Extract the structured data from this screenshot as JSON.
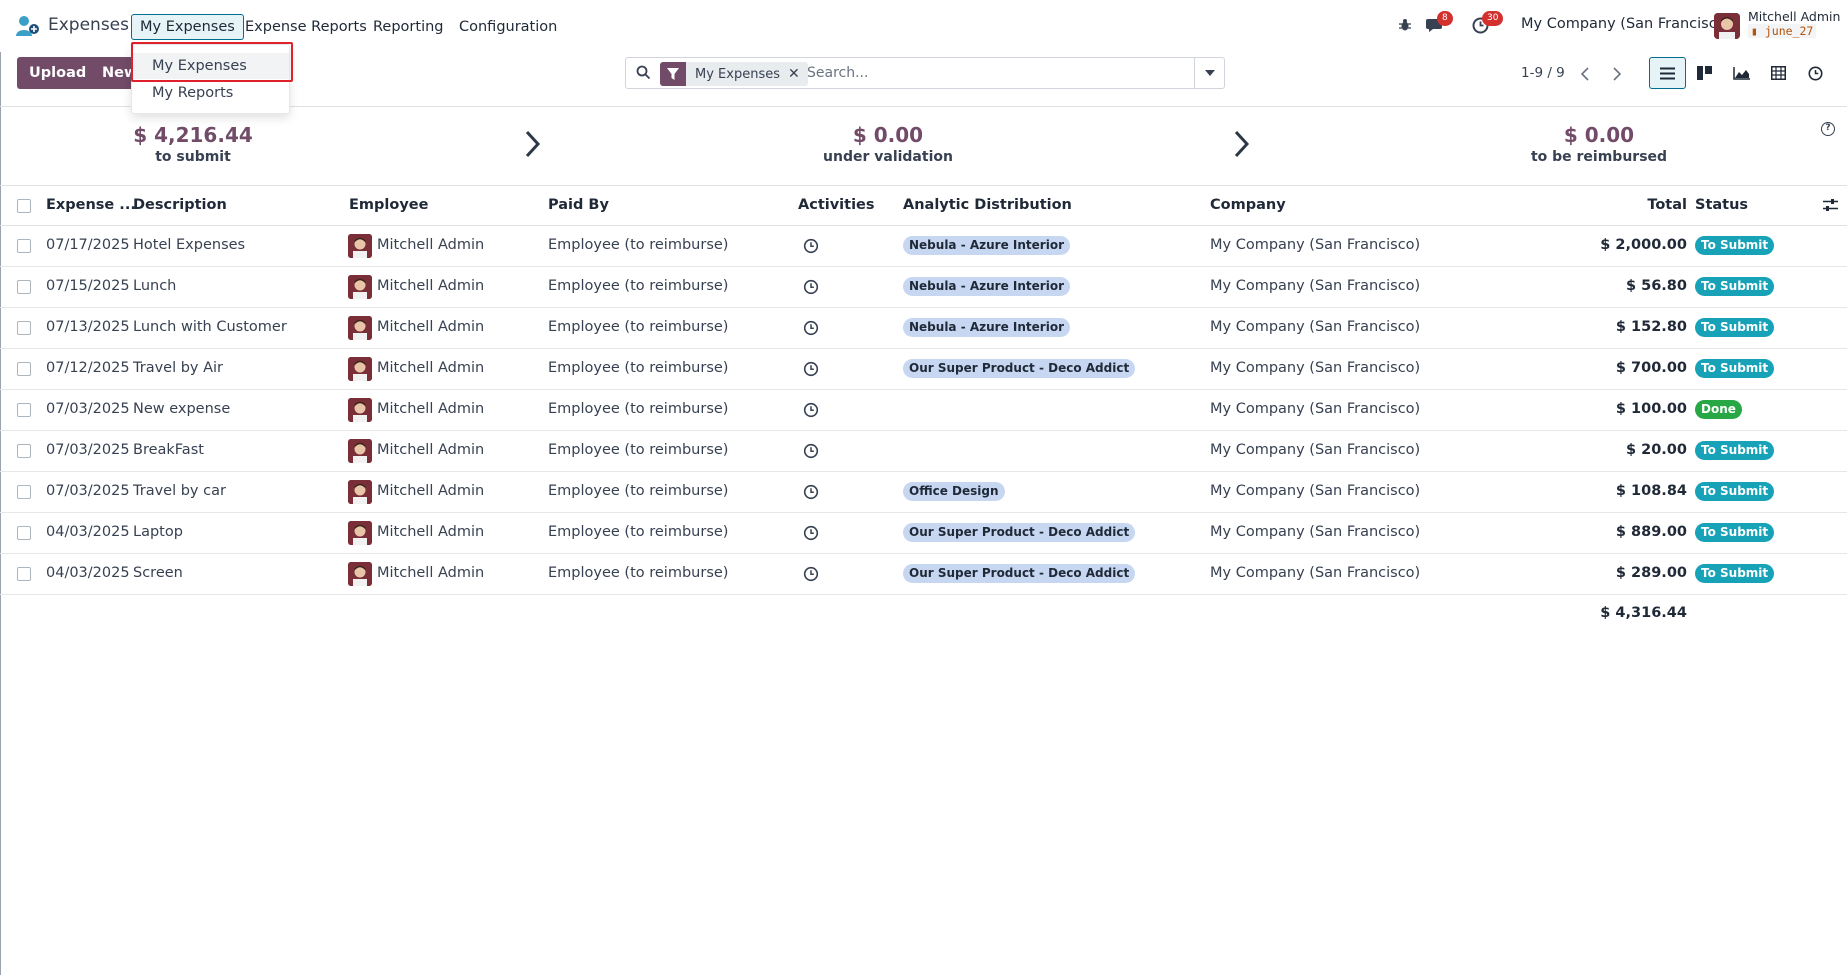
{
  "app": {
    "name": "Expenses"
  },
  "nav": {
    "menus": [
      "My Expenses",
      "Expense Reports",
      "Reporting",
      "Configuration"
    ],
    "messages_badge": "8",
    "activities_badge": "30",
    "company": "My Company (San Francisco)",
    "user_name": "Mitchell Admin",
    "database": "june_27"
  },
  "dropdown": {
    "items": [
      "My Expenses",
      "My Reports"
    ]
  },
  "control": {
    "upload_label": "Upload",
    "new_label": "New",
    "facet_label": "My Expenses",
    "search_placeholder": "Search...",
    "pager": "1-9 / 9"
  },
  "summary": [
    {
      "amount": "$ 4,216.44",
      "label": "to submit"
    },
    {
      "amount": "$ 0.00",
      "label": "under validation"
    },
    {
      "amount": "$ 0.00",
      "label": "to be reimbursed"
    }
  ],
  "table": {
    "headers": [
      "Expense ...",
      "Description",
      "Employee",
      "Paid By",
      "Activities",
      "Analytic Distribution",
      "Company",
      "Total",
      "Status"
    ],
    "rows": [
      {
        "date": "07/17/2025",
        "description": "Hotel Expenses",
        "employee": "Mitchell Admin",
        "paid_by": "Employee (to reimburse)",
        "analytic": "Nebula - Azure Interior",
        "company": "My Company (San Francisco)",
        "total": "$ 2,000.00",
        "status": "To Submit"
      },
      {
        "date": "07/15/2025",
        "description": "Lunch",
        "employee": "Mitchell Admin",
        "paid_by": "Employee (to reimburse)",
        "analytic": "Nebula - Azure Interior",
        "company": "My Company (San Francisco)",
        "total": "$ 56.80",
        "status": "To Submit"
      },
      {
        "date": "07/13/2025",
        "description": "Lunch with Customer",
        "employee": "Mitchell Admin",
        "paid_by": "Employee (to reimburse)",
        "analytic": "Nebula - Azure Interior",
        "company": "My Company (San Francisco)",
        "total": "$ 152.80",
        "status": "To Submit"
      },
      {
        "date": "07/12/2025",
        "description": "Travel by Air",
        "employee": "Mitchell Admin",
        "paid_by": "Employee (to reimburse)",
        "analytic": "Our Super Product - Deco Addict",
        "company": "My Company (San Francisco)",
        "total": "$ 700.00",
        "status": "To Submit"
      },
      {
        "date": "07/03/2025",
        "description": "New expense",
        "employee": "Mitchell Admin",
        "paid_by": "Employee (to reimburse)",
        "analytic": "",
        "company": "My Company (San Francisco)",
        "total": "$ 100.00",
        "status": "Done"
      },
      {
        "date": "07/03/2025",
        "description": "BreakFast",
        "employee": "Mitchell Admin",
        "paid_by": "Employee (to reimburse)",
        "analytic": "",
        "company": "My Company (San Francisco)",
        "total": "$ 20.00",
        "status": "To Submit"
      },
      {
        "date": "07/03/2025",
        "description": "Travel by car",
        "employee": "Mitchell Admin",
        "paid_by": "Employee (to reimburse)",
        "analytic": "Office Design",
        "company": "My Company (San Francisco)",
        "total": "$ 108.84",
        "status": "To Submit"
      },
      {
        "date": "04/03/2025",
        "description": "Laptop",
        "employee": "Mitchell Admin",
        "paid_by": "Employee (to reimburse)",
        "analytic": "Our Super Product - Deco Addict",
        "company": "My Company (San Francisco)",
        "total": "$ 889.00",
        "status": "To Submit"
      },
      {
        "date": "04/03/2025",
        "description": "Screen",
        "employee": "Mitchell Admin",
        "paid_by": "Employee (to reimburse)",
        "analytic": "Our Super Product - Deco Addict",
        "company": "My Company (San Francisco)",
        "total": "$ 289.00",
        "status": "To Submit"
      }
    ],
    "grand_total": "$ 4,316.44"
  },
  "colors": {
    "brand": "#714b67",
    "status_to_submit": "#17a2b8",
    "status_done": "#28a745",
    "tag_bg": "#c7d7f2",
    "highlight": "#e0202a"
  }
}
